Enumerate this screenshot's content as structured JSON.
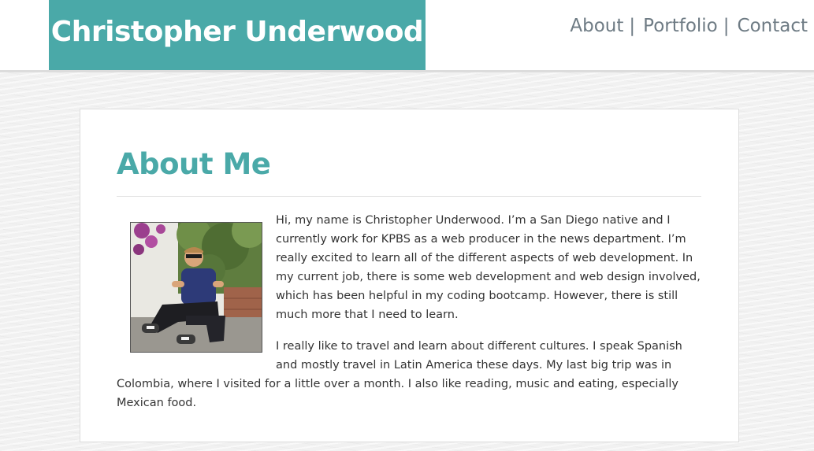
{
  "header": {
    "brand": "Christopher Underwood",
    "nav": [
      {
        "label": "About",
        "separator": "|"
      },
      {
        "label": "Portfolio",
        "separator": "|"
      },
      {
        "label": "Contact",
        "separator": ""
      }
    ]
  },
  "main": {
    "title": "About Me",
    "photo_alt": "man-sitting-outdoors-photo",
    "paragraphs": [
      "Hi, my name is Christopher Underwood. I’m a San Diego native and I currently work for KPBS as a web producer in the news department. I’m really excited to learn all of the different aspects of web development. In my current job, there is some web development and web design involved, which has been helpful in my coding bootcamp. However, there is still much more that I need to learn.",
      "I really like to travel and learn about different cultures. I speak Spanish and mostly travel in Latin America these days. My last big trip was in Colombia, where I visited for a little over a month. I also like reading, music and eating, especially Mexican food."
    ]
  },
  "colors": {
    "accent": "#4aa9a8",
    "nav_text": "#6e7b84",
    "body_text": "#333333"
  }
}
